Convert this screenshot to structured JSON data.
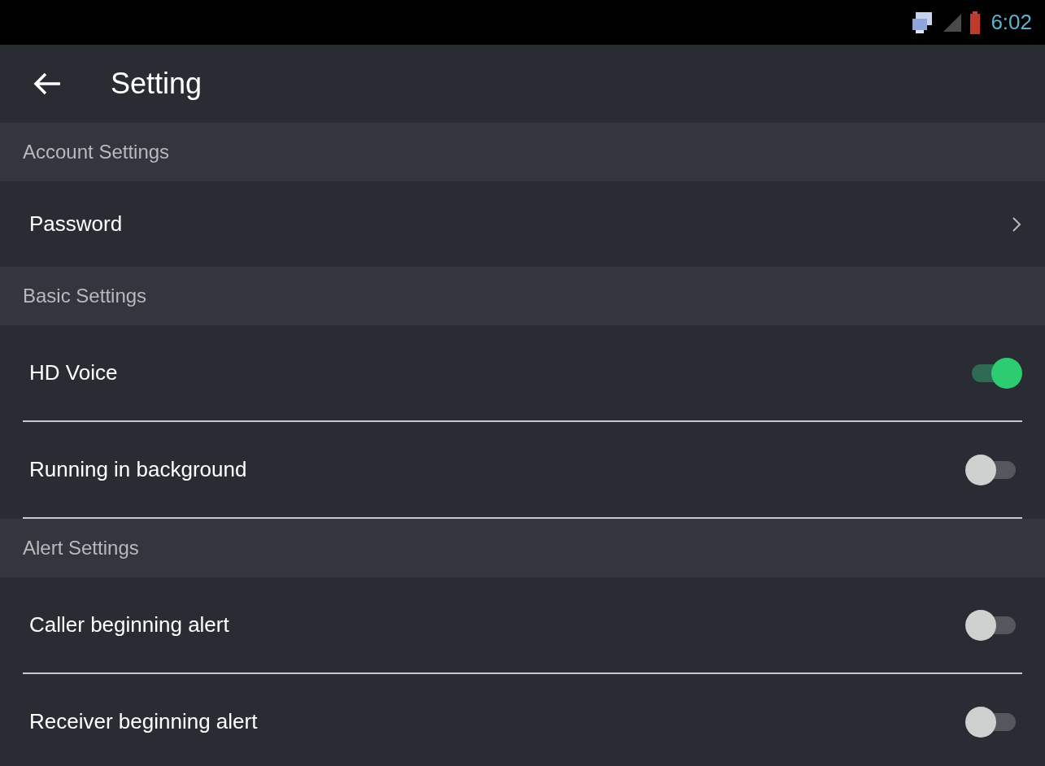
{
  "status_bar": {
    "time": "6:02"
  },
  "header": {
    "title": "Setting"
  },
  "sections": [
    {
      "title": "Account Settings",
      "items": [
        {
          "label": "Password",
          "kind": "link"
        }
      ]
    },
    {
      "title": "Basic Settings",
      "items": [
        {
          "label": "HD Voice",
          "kind": "toggle",
          "on": true
        },
        {
          "label": "Running in background",
          "kind": "toggle",
          "on": false
        }
      ]
    },
    {
      "title": "Alert Settings",
      "items": [
        {
          "label": "Caller beginning alert",
          "kind": "toggle",
          "on": false
        },
        {
          "label": "Receiver beginning alert",
          "kind": "toggle",
          "on": false
        }
      ]
    }
  ]
}
